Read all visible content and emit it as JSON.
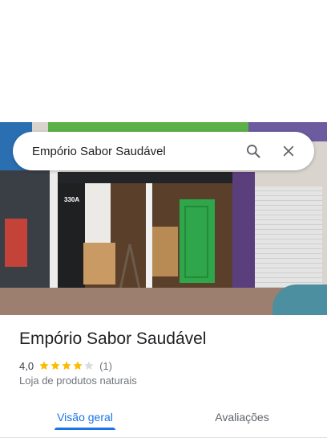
{
  "search": {
    "query": "Empório Sabor Saudável",
    "search_icon": "search-icon",
    "close_icon": "close-icon"
  },
  "photo": {
    "shop_number": "330A"
  },
  "place": {
    "title": "Empório Sabor Saudável",
    "rating": "4,0",
    "rating_value": 4,
    "rating_max": 5,
    "review_count": "(1)",
    "category": "Loja de produtos naturais"
  },
  "tabs": [
    {
      "label": "Visão geral",
      "active": true
    },
    {
      "label": "Avaliações",
      "active": false
    }
  ],
  "colors": {
    "accent": "#1a73e8",
    "star": "#fbbc04",
    "star_empty": "#dadce0"
  }
}
